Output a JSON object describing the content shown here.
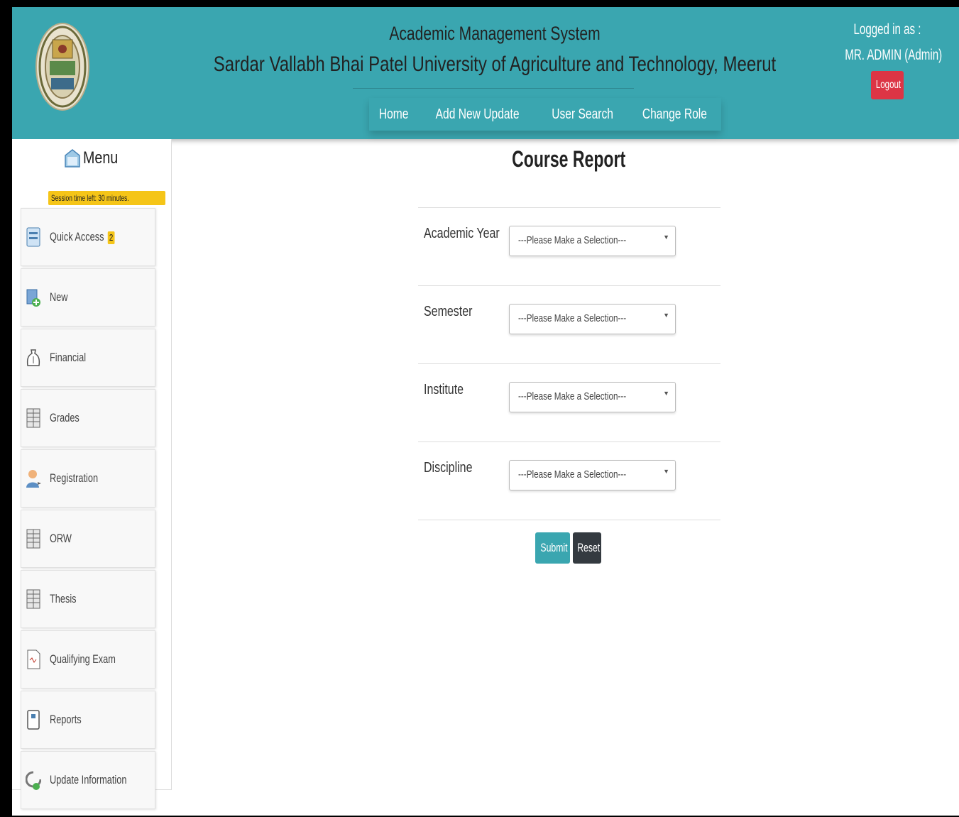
{
  "header": {
    "system_title": "Academic Management System",
    "university_title": "Sardar Vallabh Bhai Patel University of Agriculture and Technology, Meerut",
    "nav": [
      {
        "label": "Home"
      },
      {
        "label": "Add New Update"
      },
      {
        "label": "User Search"
      },
      {
        "label": "Change Role"
      }
    ],
    "login_label": "Logged in as :",
    "login_user": "MR. ADMIN (Admin)",
    "logout_label": "Logout",
    "colors": {
      "header_bg": "#3aa6b0",
      "logout_bg": "#dc3545"
    }
  },
  "sidebar": {
    "title": "Menu",
    "session_text": "Session time left: 30 minutes.",
    "items": [
      {
        "label": "Quick Access",
        "badge": "2",
        "icon": "quick-access-icon"
      },
      {
        "label": "New",
        "icon": "new-icon"
      },
      {
        "label": "Financial",
        "icon": "financial-icon"
      },
      {
        "label": "Grades",
        "icon": "grades-icon"
      },
      {
        "label": "Registration",
        "icon": "registration-icon"
      },
      {
        "label": "ORW",
        "icon": "orw-icon"
      },
      {
        "label": "Thesis",
        "icon": "thesis-icon"
      },
      {
        "label": "Qualifying Exam",
        "icon": "qualifying-exam-icon"
      },
      {
        "label": "Reports",
        "icon": "reports-icon"
      },
      {
        "label": "Update Information",
        "icon": "update-information-icon"
      }
    ]
  },
  "main": {
    "title": "Course Report",
    "fields": [
      {
        "label": "Academic Year",
        "value": "---Please Make a Selection---"
      },
      {
        "label": "Semester",
        "value": "---Please Make a Selection---"
      },
      {
        "label": "Institute",
        "value": "---Please Make a Selection---"
      },
      {
        "label": "Discipline",
        "value": "---Please Make a Selection---"
      }
    ],
    "submit_label": "Submit",
    "reset_label": "Reset",
    "colors": {
      "submit_bg": "#3aa6b0",
      "reset_bg": "#343a40"
    }
  }
}
